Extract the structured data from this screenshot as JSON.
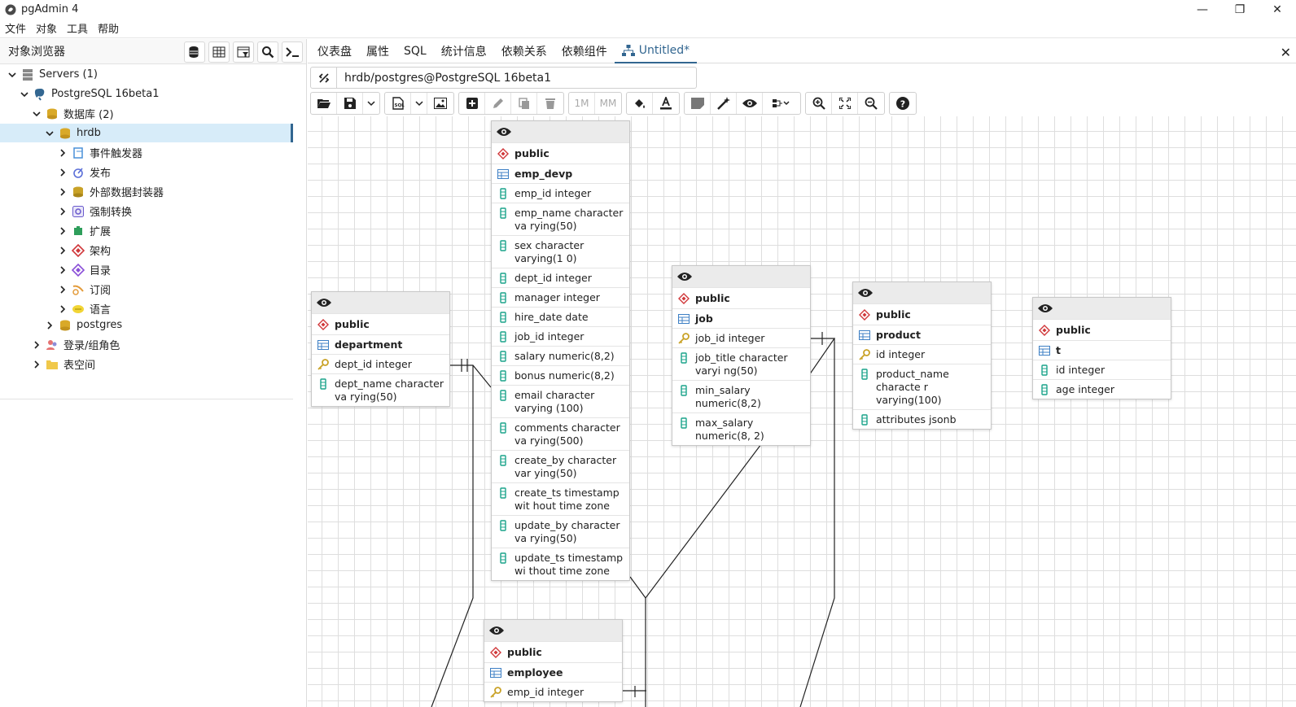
{
  "window": {
    "title": "pgAdmin 4"
  },
  "menu": [
    "文件",
    "对象",
    "工具",
    "帮助"
  ],
  "browser": {
    "title": "对象浏览器",
    "tree": [
      {
        "label": "Servers (1)",
        "icon": "servers-icon"
      },
      {
        "label": "PostgreSQL 16beta1",
        "icon": "elephant-icon"
      },
      {
        "label": "数据库 (2)",
        "icon": "databases-icon"
      },
      {
        "label": "hrdb",
        "icon": "database-icon"
      },
      {
        "label": "事件触发器",
        "icon": "event-trigger-icon"
      },
      {
        "label": "发布",
        "icon": "publication-icon"
      },
      {
        "label": "外部数据封装器",
        "icon": "fdw-icon"
      },
      {
        "label": "强制转换",
        "icon": "cast-icon"
      },
      {
        "label": "扩展",
        "icon": "extension-icon"
      },
      {
        "label": "架构",
        "icon": "schema-icon"
      },
      {
        "label": "目录",
        "icon": "catalog-icon"
      },
      {
        "label": "订阅",
        "icon": "subscription-icon"
      },
      {
        "label": "语言",
        "icon": "language-icon"
      },
      {
        "label": "postgres",
        "icon": "database-icon"
      },
      {
        "label": "登录/组角色",
        "icon": "roles-icon"
      },
      {
        "label": "表空间",
        "icon": "tablespace-icon"
      }
    ]
  },
  "tabs": [
    "仪表盘",
    "属性",
    "SQL",
    "统计信息",
    "依赖关系",
    "依赖组件",
    "Untitled*"
  ],
  "connection": "hrdb/postgres@PostgreSQL 16beta1",
  "toolbar": {
    "one_to_many": "1M",
    "many_to_many": "MM"
  },
  "erd": {
    "schema_label": "public",
    "tables": [
      {
        "name": "department",
        "columns": [
          {
            "text": "dept_id integer",
            "pk": true
          },
          {
            "text": "dept_name character va rying(50)",
            "pk": false
          }
        ]
      },
      {
        "name": "emp_devp",
        "columns": [
          {
            "text": "emp_id integer",
            "pk": false
          },
          {
            "text": "emp_name character va rying(50)",
            "pk": false
          },
          {
            "text": "sex character varying(1 0)",
            "pk": false
          },
          {
            "text": "dept_id integer",
            "pk": false
          },
          {
            "text": "manager integer",
            "pk": false
          },
          {
            "text": "hire_date date",
            "pk": false
          },
          {
            "text": "job_id integer",
            "pk": false
          },
          {
            "text": "salary numeric(8,2)",
            "pk": false
          },
          {
            "text": "bonus numeric(8,2)",
            "pk": false
          },
          {
            "text": "email character varying (100)",
            "pk": false
          },
          {
            "text": "comments character va rying(500)",
            "pk": false
          },
          {
            "text": "create_by character var ying(50)",
            "pk": false
          },
          {
            "text": "create_ts timestamp wit hout time zone",
            "pk": false
          },
          {
            "text": "update_by character va rying(50)",
            "pk": false
          },
          {
            "text": "update_ts timestamp wi thout time zone",
            "pk": false
          }
        ]
      },
      {
        "name": "job",
        "columns": [
          {
            "text": "job_id integer",
            "pk": true
          },
          {
            "text": "job_title character varyi ng(50)",
            "pk": false
          },
          {
            "text": "min_salary numeric(8,2)",
            "pk": false
          },
          {
            "text": "max_salary numeric(8, 2)",
            "pk": false
          }
        ]
      },
      {
        "name": "product",
        "columns": [
          {
            "text": "id integer",
            "pk": true
          },
          {
            "text": "product_name characte r varying(100)",
            "pk": false
          },
          {
            "text": "attributes jsonb",
            "pk": false
          }
        ]
      },
      {
        "name": "t",
        "columns": [
          {
            "text": "id integer",
            "pk": false
          },
          {
            "text": "age integer",
            "pk": false
          }
        ]
      },
      {
        "name": "employee",
        "columns": [
          {
            "text": "emp_id integer",
            "pk": true
          }
        ]
      }
    ]
  },
  "colors": {
    "accent": "#326690",
    "column_icon": "#1aa38a",
    "schema_icon": "#d0373a",
    "key_icon": "#c9a227"
  }
}
